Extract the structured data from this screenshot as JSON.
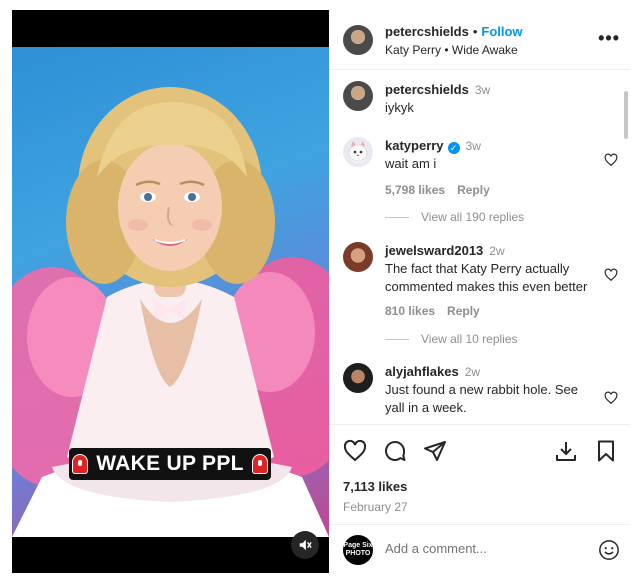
{
  "media": {
    "caption_text": "WAKE UP PPL",
    "caption_icon": "siren-emoji",
    "mute_icon": "speaker-muted-icon"
  },
  "header": {
    "username": "petercshields",
    "separator": "•",
    "follow_label": "Follow",
    "music": "Katy Perry • Wide Awake",
    "more_icon": "more-horizontal-icon"
  },
  "comments": [
    {
      "username": "petercshields",
      "time": "3w",
      "text": "iykyk"
    },
    {
      "username": "katyperry",
      "verified": true,
      "time": "3w",
      "text": "wait am i",
      "likes": "5,798 likes",
      "reply": "Reply",
      "view_replies": "View all 190 replies"
    },
    {
      "username": "jewelsward2013",
      "time": "2w",
      "text_line1": "The fact that Katy Perry actually",
      "text_line2": "commented makes this even better",
      "likes": "810 likes",
      "reply": "Reply",
      "view_replies": "View all 10 replies"
    },
    {
      "username": "alyjahflakes",
      "time": "2w",
      "text_line1": "Just found a new rabbit hole. See",
      "text_line2": "yall in a week."
    }
  ],
  "actions": {
    "like_icon": "heart-icon",
    "comment_icon": "comment-bubble-icon",
    "share_icon": "paper-plane-icon",
    "download_icon": "download-icon",
    "save_icon": "bookmark-icon",
    "likes": "7,113 likes",
    "date": "February 27"
  },
  "add_comment": {
    "avatar_text_line1": "Page Six",
    "avatar_text_line2": "PHOTO",
    "placeholder": "Add a comment...",
    "emoji_icon": "smiley-icon"
  },
  "colors": {
    "accent": "#0095f6",
    "secondary_text": "#8e8e8e",
    "caption_bg": "#111111",
    "siren_red": "#e02424"
  }
}
